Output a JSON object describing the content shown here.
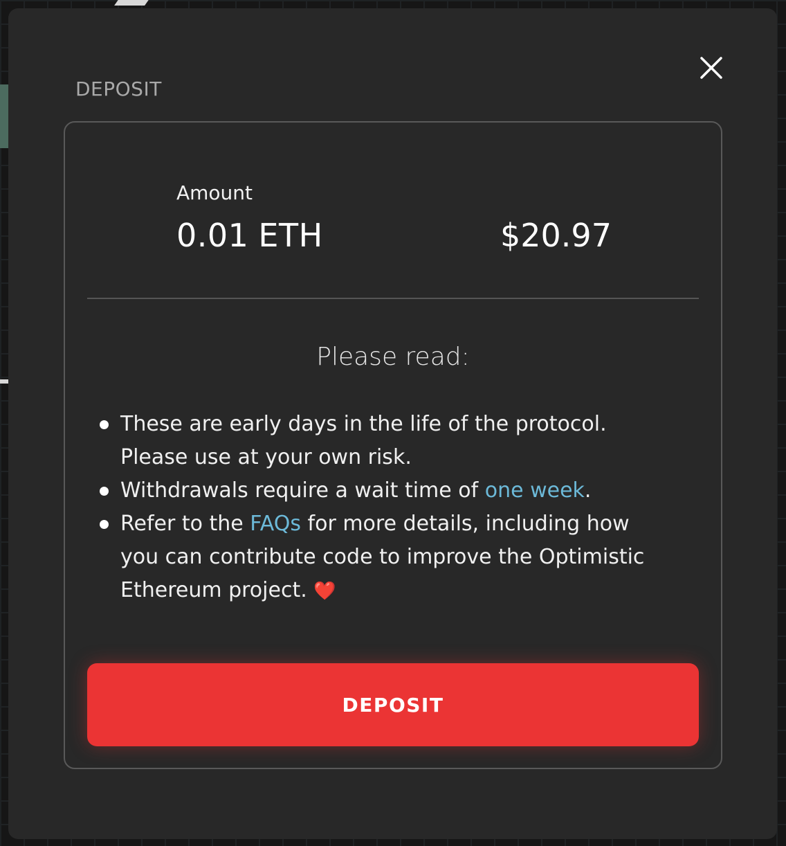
{
  "modal": {
    "title": "DEPOSIT",
    "close_icon": "close-icon"
  },
  "amount": {
    "label": "Amount",
    "value": "0.01",
    "unit": "ETH",
    "usd": "$20.97"
  },
  "notice": {
    "heading": "Please read:",
    "items": [
      {
        "text": "These are early days in the life of the protocol. Please use at your own risk."
      },
      {
        "before": "Withdrawals require a wait time of ",
        "link": "one week",
        "after": "."
      },
      {
        "before": "Refer to the ",
        "link": "FAQs",
        "after": " for more details, including how you can contribute code to improve the Optimistic Ethereum project. ",
        "emoji": "❤️"
      }
    ]
  },
  "actions": {
    "deposit_label": "DEPOSIT"
  },
  "colors": {
    "accent": "#eb3434",
    "link": "#6cb9d8",
    "modal_bg": "#282828",
    "page_bg": "#161616"
  }
}
